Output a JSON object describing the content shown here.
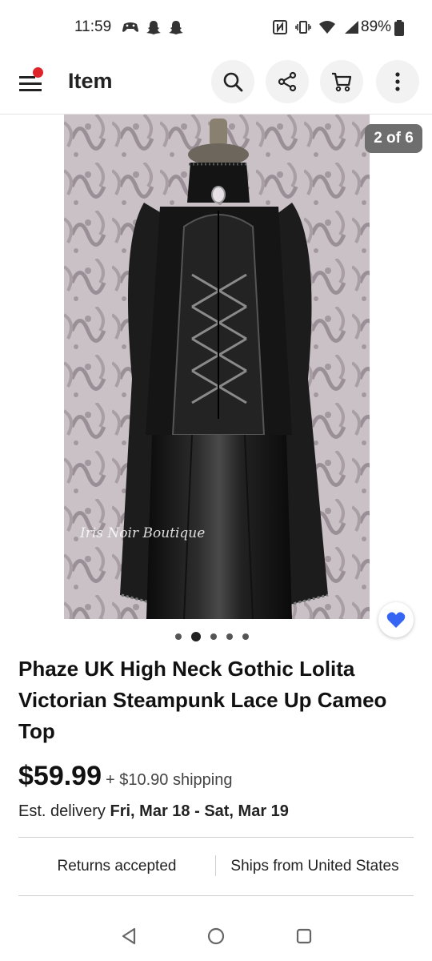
{
  "status_bar": {
    "time": "11:59",
    "battery": "89%",
    "left_icons": [
      "gamepad-icon",
      "snapchat-icon",
      "snapchat-icon"
    ],
    "right_icons": [
      "nfc-icon",
      "vibrate-icon",
      "wifi-icon",
      "signal-icon",
      "battery-icon"
    ]
  },
  "header": {
    "title": "Item",
    "menu_icon": "menu-icon",
    "notification_color": "#e0242b",
    "actions": [
      "search-icon",
      "share-icon",
      "cart-icon",
      "more-vertical-icon"
    ]
  },
  "gallery": {
    "counter": "2 of 6",
    "watermark": "Iris Noir Boutique",
    "current_index": 2,
    "total_dots": 5,
    "watch_icon": "heart-icon",
    "accent_color": "#3665f3"
  },
  "item": {
    "title": "Phaze UK High Neck Gothic Lolita Victorian Steampunk Lace Up Cameo Top",
    "price": "$59.99",
    "shipping": "+ $10.90 shipping",
    "delivery_label": "Est. delivery",
    "delivery_dates": "Fri, Mar 18 - Sat, Mar 19",
    "returns": "Returns accepted",
    "ships_from": "Ships from United States"
  },
  "nav_bar": {
    "buttons": [
      "back-triangle-icon",
      "home-circle-icon",
      "recents-square-icon"
    ]
  }
}
